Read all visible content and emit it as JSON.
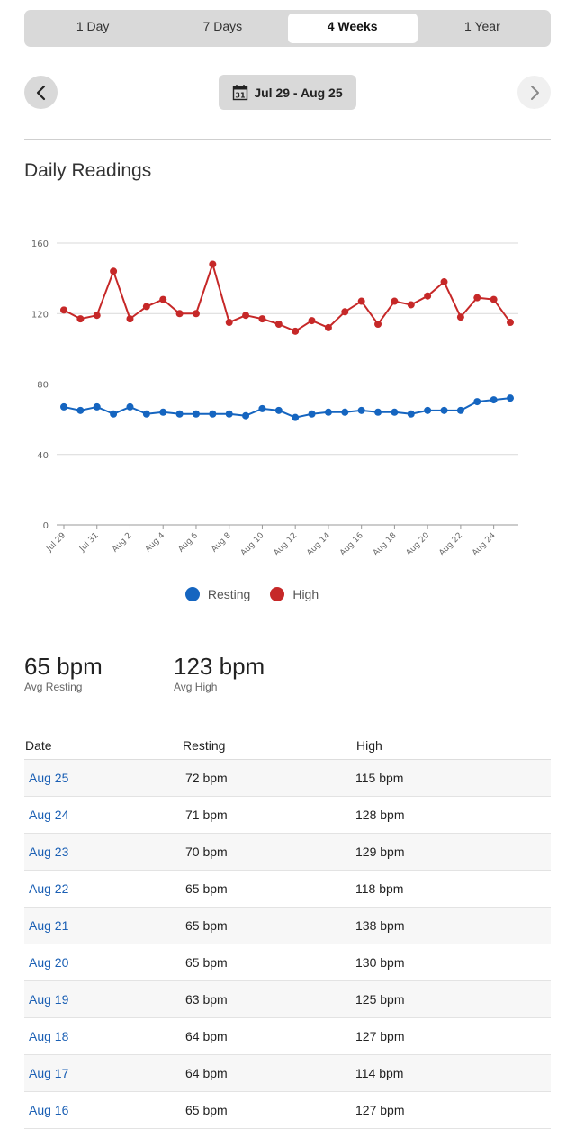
{
  "range_tabs": [
    {
      "label": "1 Day",
      "active": false
    },
    {
      "label": "7 Days",
      "active": false
    },
    {
      "label": "4 Weeks",
      "active": true
    },
    {
      "label": "1 Year",
      "active": false
    }
  ],
  "date_range": {
    "label": "Jul 29 - Aug 25",
    "calendar_day": "31"
  },
  "section_title": "Daily Readings",
  "legend": [
    {
      "label": "Resting",
      "color": "#1565c0"
    },
    {
      "label": "High",
      "color": "#c62828"
    }
  ],
  "stats": {
    "resting": {
      "value": "65 bpm",
      "label": "Avg Resting"
    },
    "high": {
      "value": "123 bpm",
      "label": "Avg High"
    }
  },
  "table": {
    "headers": {
      "date": "Date",
      "resting": "Resting",
      "high": "High"
    },
    "rows": [
      {
        "date": "Aug 25",
        "resting": "72 bpm",
        "high": "115 bpm"
      },
      {
        "date": "Aug 24",
        "resting": "71 bpm",
        "high": "128 bpm"
      },
      {
        "date": "Aug 23",
        "resting": "70 bpm",
        "high": "129 bpm"
      },
      {
        "date": "Aug 22",
        "resting": "65 bpm",
        "high": "118 bpm"
      },
      {
        "date": "Aug 21",
        "resting": "65 bpm",
        "high": "138 bpm"
      },
      {
        "date": "Aug 20",
        "resting": "65 bpm",
        "high": "130 bpm"
      },
      {
        "date": "Aug 19",
        "resting": "63 bpm",
        "high": "125 bpm"
      },
      {
        "date": "Aug 18",
        "resting": "64 bpm",
        "high": "127 bpm"
      },
      {
        "date": "Aug 17",
        "resting": "64 bpm",
        "high": "114 bpm"
      },
      {
        "date": "Aug 16",
        "resting": "65 bpm",
        "high": "127 bpm"
      }
    ]
  },
  "chart_data": {
    "type": "line",
    "x": [
      "Jul 29",
      "Jul 30",
      "Jul 31",
      "Aug 1",
      "Aug 2",
      "Aug 3",
      "Aug 4",
      "Aug 5",
      "Aug 6",
      "Aug 7",
      "Aug 8",
      "Aug 9",
      "Aug 10",
      "Aug 11",
      "Aug 12",
      "Aug 13",
      "Aug 14",
      "Aug 15",
      "Aug 16",
      "Aug 17",
      "Aug 18",
      "Aug 19",
      "Aug 20",
      "Aug 21",
      "Aug 22",
      "Aug 23",
      "Aug 24",
      "Aug 25"
    ],
    "x_tick_labels": [
      "Jul 29",
      "Jul 31",
      "Aug 2",
      "Aug 4",
      "Aug 6",
      "Aug 8",
      "Aug 10",
      "Aug 12",
      "Aug 14",
      "Aug 16",
      "Aug 18",
      "Aug 20",
      "Aug 22",
      "Aug 24"
    ],
    "series": [
      {
        "name": "Resting",
        "color": "#1565c0",
        "values": [
          67,
          65,
          67,
          63,
          67,
          63,
          64,
          63,
          63,
          63,
          63,
          62,
          66,
          65,
          61,
          63,
          64,
          64,
          65,
          64,
          64,
          63,
          65,
          65,
          65,
          70,
          71,
          72
        ]
      },
      {
        "name": "High",
        "color": "#c62828",
        "values": [
          122,
          117,
          119,
          144,
          117,
          124,
          128,
          120,
          120,
          148,
          115,
          119,
          117,
          114,
          110,
          116,
          112,
          121,
          127,
          114,
          127,
          125,
          130,
          138,
          118,
          129,
          128,
          115
        ]
      }
    ],
    "yticks": [
      0,
      40,
      80,
      120,
      160
    ],
    "ylim": [
      0,
      160
    ],
    "grid": true,
    "legend_position": "bottom"
  }
}
